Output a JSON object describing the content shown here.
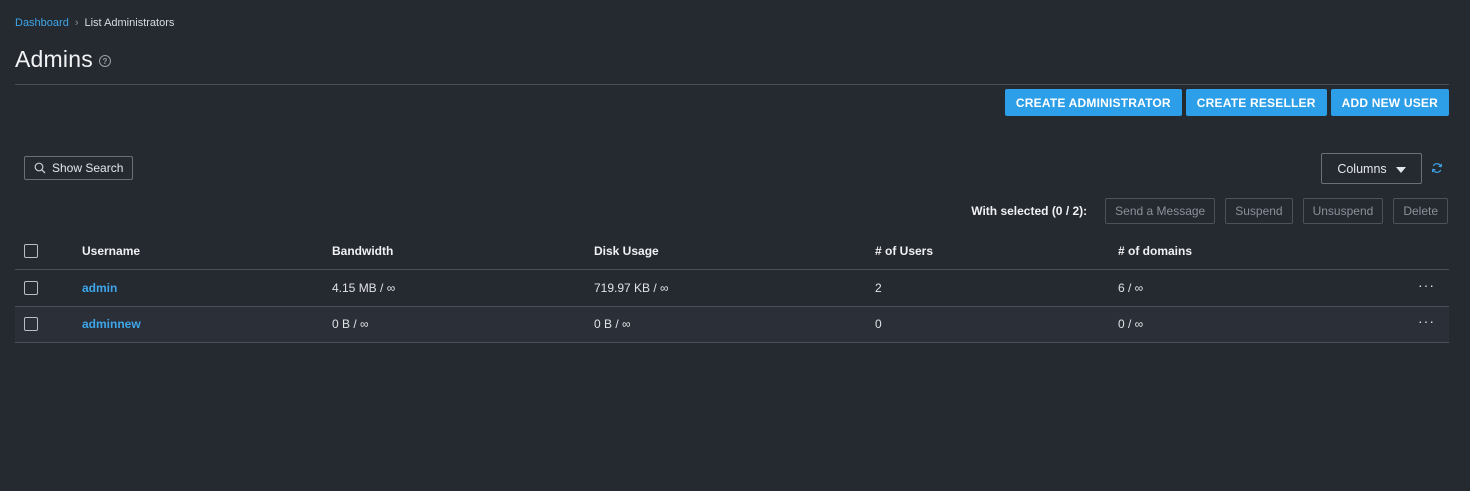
{
  "breadcrumb": {
    "home": "Dashboard",
    "current": "List Administrators"
  },
  "page": {
    "title": "Admins",
    "help_glyph": "?"
  },
  "actions": {
    "create_admin": "CREATE ADMINISTRATOR",
    "create_reseller": "CREATE RESELLER",
    "add_user": "ADD NEW USER"
  },
  "toolbar": {
    "show_search": "Show Search",
    "columns": "Columns"
  },
  "bulk": {
    "label": "With selected (0 / 2):",
    "send_message": "Send a Message",
    "suspend": "Suspend",
    "unsuspend": "Unsuspend",
    "delete": "Delete"
  },
  "table": {
    "headers": {
      "username": "Username",
      "bandwidth": "Bandwidth",
      "disk": "Disk Usage",
      "users": "# of Users",
      "domains": "# of domains"
    },
    "rows": [
      {
        "username": "admin",
        "bandwidth": "4.15 MB / ∞",
        "disk": "719.97 KB / ∞",
        "users": "2",
        "domains": "6 / ∞",
        "menu": "···"
      },
      {
        "username": "adminnew",
        "bandwidth": "0 B / ∞",
        "disk": "0 B / ∞",
        "users": "0",
        "domains": "0 / ∞",
        "menu": "···"
      }
    ]
  },
  "colors": {
    "background": "#252930",
    "accent": "#2d9ee8",
    "link": "#3ea6ea"
  }
}
